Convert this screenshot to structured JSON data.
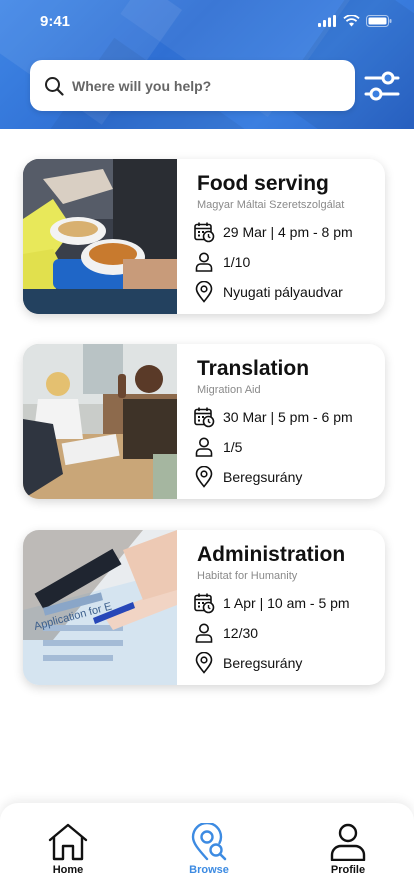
{
  "status": {
    "time": "9:41"
  },
  "search": {
    "placeholder": "Where will you help?"
  },
  "opportunities": [
    {
      "title": "Food serving",
      "org": "Magyar Máltai Szeretszolgálat",
      "date": "29 Mar | 4 pm - 8 pm",
      "spots": "1/10",
      "location": "Nyugati pályaudvar"
    },
    {
      "title": "Translation",
      "org": "Migration Aid",
      "date": "30 Mar | 5 pm - 6 pm",
      "spots": "1/5",
      "location": "Beregsurány"
    },
    {
      "title": "Administration",
      "org": "Habitat for Humanity",
      "date": "1 Apr | 10 am - 5 pm",
      "spots": "12/30",
      "location": "Beregsurány"
    }
  ],
  "images": {
    "form_text": "Application for E"
  },
  "nav": {
    "home": "Home",
    "browse": "Browse",
    "profile": "Profile"
  },
  "colors": {
    "header_blue": "#3b7fe0",
    "active_nav": "#3d8be2",
    "text_dark": "#111111"
  }
}
